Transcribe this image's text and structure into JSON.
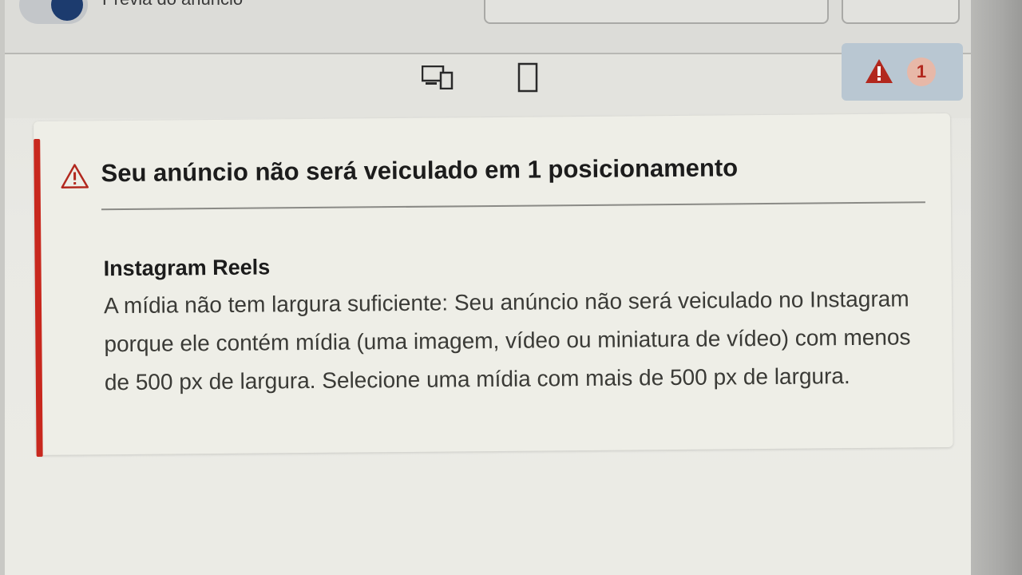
{
  "top_bar": {
    "preview_toggle_label": "Prévia do anúncio"
  },
  "device_toggle": {
    "desktop_icon": "desktop-mobile-icon",
    "mobile_icon": "mobile-icon"
  },
  "warnings_badge": {
    "icon": "warning-icon",
    "count": "1"
  },
  "alert": {
    "title": "Seu anúncio não será veiculado em 1 posicionamento",
    "placement_name": "Instagram Reels",
    "description": "A mídia não tem largura suficiente: Seu anúncio não será veiculado no Instagram porque ele contém mídia (uma imagem, vídeo ou miniatura de vídeo) com menos de 500 px de largura. Selecione uma mídia com mais de 500 px de largura."
  },
  "colors": {
    "error_red": "#c8281e",
    "toggle_on": "#1c3b6e",
    "badge_bg": "#b9c7d2"
  }
}
